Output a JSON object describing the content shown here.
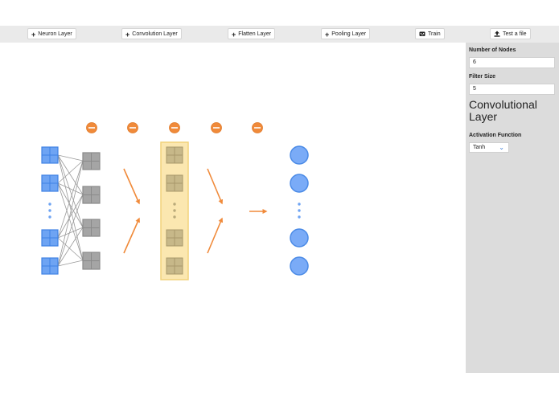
{
  "toolbar": {
    "neuron_layer": "Neuron Layer",
    "convolution_layer": "Convolution Layer",
    "flatten_layer": "Flatten Layer",
    "pooling_layer": "Pooling Layer",
    "train": "Train",
    "test_file": "Test a file"
  },
  "sidebar": {
    "nodes_label": "Number of Nodes",
    "nodes_value": "6",
    "filter_label": "Filter Size",
    "filter_value": "5",
    "layer_title": "Convolutional Layer",
    "activation_label": "Activation Function",
    "activation_value": "Tanh"
  },
  "icons": {
    "add": "plus-icon",
    "train": "robot-icon",
    "upload": "upload-icon",
    "remove": "minus-circle-icon",
    "chevron": "chevron-down-icon"
  },
  "colors": {
    "toolbar_bg": "#eaeaea",
    "sidebar_bg": "#dcdcdc",
    "input_blue": "#6ea4f3",
    "grey_node": "#a5a5a5",
    "highlight_fill": "#fbe7b0",
    "highlight_border": "#f2d27a",
    "tan_node": "#c7b889",
    "orange": "#f08a3a",
    "output_blue": "#7aabf7"
  }
}
